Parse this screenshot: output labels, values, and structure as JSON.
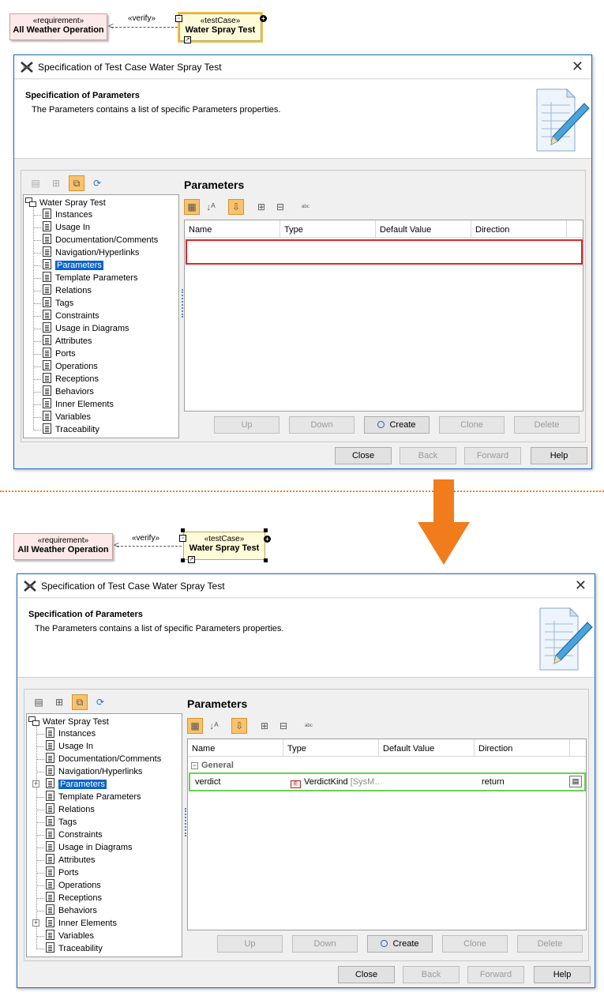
{
  "diagram": {
    "requirement_stereotype": "«requirement»",
    "requirement_name": "All Weather Operation",
    "verify_label": "«verify»",
    "testcase_stereotype": "«testCase»",
    "testcase_name": "Water Spray Test"
  },
  "dialog": {
    "title": "Specification of Test Case Water Spray Test",
    "header_title": "Specification of Parameters",
    "header_desc": "The Parameters contains a list of specific Parameters properties.",
    "panel_title": "Parameters",
    "tree_root": "Water Spray Test",
    "tree_items": [
      "Instances",
      "Usage In",
      "Documentation/Comments",
      "Navigation/Hyperlinks",
      "Parameters",
      "Template Parameters",
      "Relations",
      "Tags",
      "Constraints",
      "Usage in Diagrams",
      "Attributes",
      "Ports",
      "Operations",
      "Receptions",
      "Behaviors",
      "Inner Elements",
      "Variables",
      "Traceability"
    ],
    "selected_tree_item": "Parameters",
    "columns": [
      "Name",
      "Type",
      "Default Value",
      "Direction"
    ],
    "grid_buttons": {
      "up": "Up",
      "down": "Down",
      "create": "Create",
      "clone": "Clone",
      "delete": "Delete"
    },
    "dialog_buttons": {
      "close": "Close",
      "back": "Back",
      "forward": "Forward",
      "help": "Help"
    }
  },
  "after": {
    "group_label": "General",
    "row": {
      "name": "verdict",
      "type": "VerdictKind",
      "type_suffix": "[SysM…",
      "default": "",
      "direction": "return"
    }
  },
  "colors": {
    "highlight_empty": "#e02424",
    "highlight_row": "#6ad052",
    "arrow": "#f07c1c",
    "title_accent": "#1a6fbf"
  }
}
